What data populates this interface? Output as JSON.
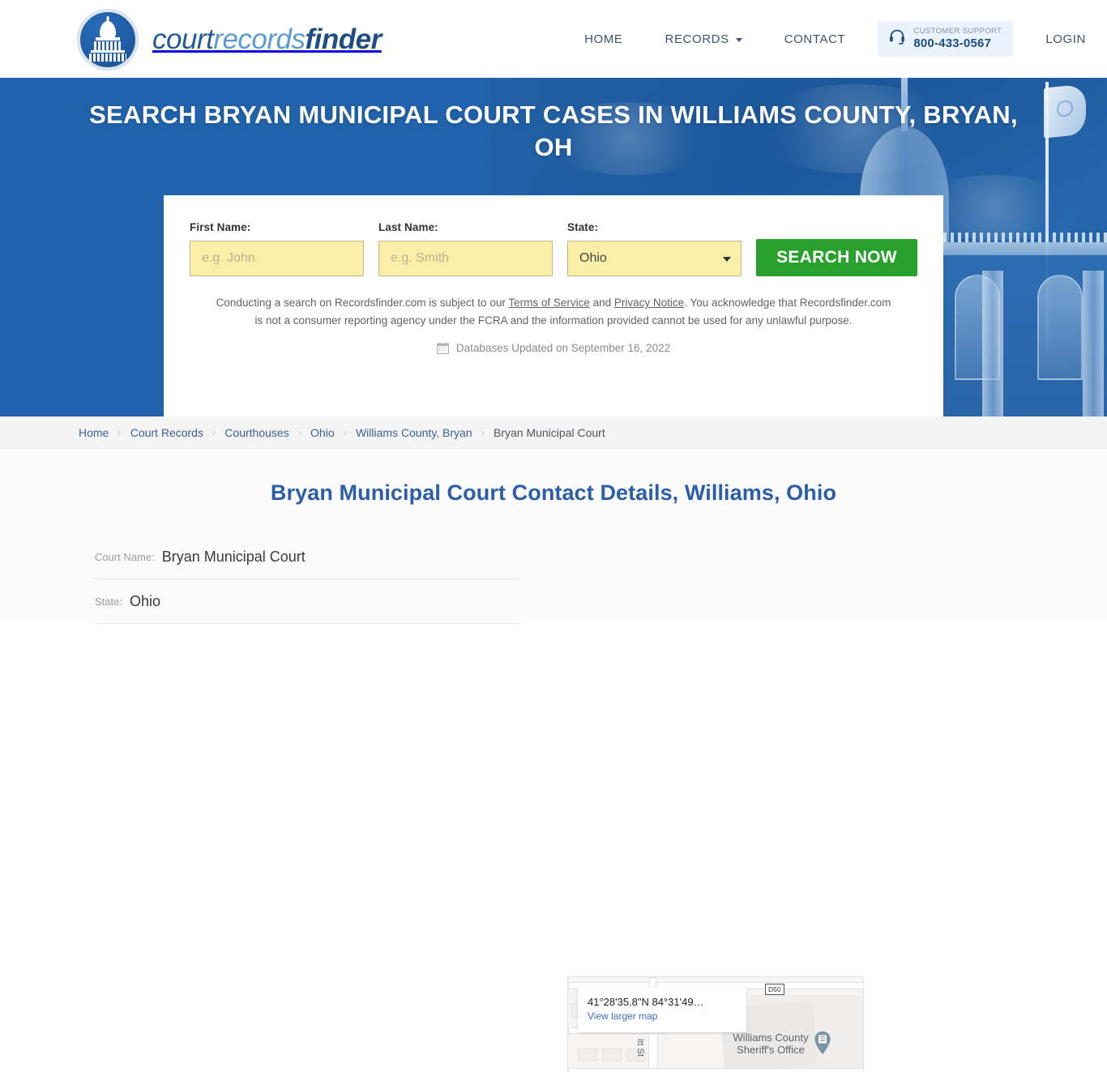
{
  "header": {
    "brand": {
      "part1": "court",
      "part2": "records",
      "part3": "finder",
      "logo_icon": "capitol-dome-icon"
    },
    "nav": [
      {
        "label": "HOME",
        "name": "nav-home"
      },
      {
        "label": "RECORDS",
        "name": "nav-records",
        "has_chevron": true
      },
      {
        "label": "CONTACT",
        "name": "nav-contact"
      },
      {
        "label": "LOGIN",
        "name": "nav-login"
      }
    ],
    "support": {
      "icon": "headset-icon",
      "label": "CUSTOMER SUPPORT",
      "phone": "800-433-0567"
    }
  },
  "hero": {
    "title": "SEARCH BRYAN MUNICIPAL COURT CASES IN WILLIAMS COUNTY, BRYAN, OH",
    "background_color": "#2062ab"
  },
  "search_form": {
    "first_name": {
      "label": "First Name:",
      "placeholder": "e.g. John",
      "value": ""
    },
    "last_name": {
      "label": "Last Name:",
      "placeholder": "e.g. Smith",
      "value": ""
    },
    "state": {
      "label": "State:",
      "value": "Ohio"
    },
    "submit_label": "SEARCH NOW",
    "submit_color": "#27a02c",
    "disclaimer": {
      "part1": "Conducting a search on Recordsfinder.com is subject to our ",
      "link1": "Terms of Service",
      "part2": " and ",
      "link2": "Privacy Notice",
      "part3": ". You acknowledge that Recordsfinder.com is not a consumer reporting agency under the FCRA and the information provided cannot be used for any unlawful purpose."
    },
    "updated": {
      "icon": "calendar-icon",
      "text": "Databases Updated on September 16, 2022"
    }
  },
  "breadcrumb": {
    "separator": "›",
    "items": [
      {
        "label": "Home",
        "current": false
      },
      {
        "label": "Court Records",
        "current": false
      },
      {
        "label": "Courthouses",
        "current": false
      },
      {
        "label": "Ohio",
        "current": false
      },
      {
        "label": "Williams County, Bryan",
        "current": false
      },
      {
        "label": "Bryan Municipal Court",
        "current": true
      }
    ]
  },
  "main": {
    "heading": "Bryan Municipal Court Contact Details, Williams, Ohio",
    "details": [
      {
        "label": "Court Name:",
        "value": "Bryan Municipal Court"
      },
      {
        "label": "State:",
        "value": "Ohio"
      }
    ]
  },
  "map": {
    "coordinates": "41°28'35.8\"N 84°31'49…",
    "view_larger": "View larger map",
    "poi_line1": "Williams County",
    "poi_line2": "Sheriff's Office",
    "route_badge": "D50",
    "street_label": "itt St",
    "pin_icon": "map-pin-icon"
  }
}
